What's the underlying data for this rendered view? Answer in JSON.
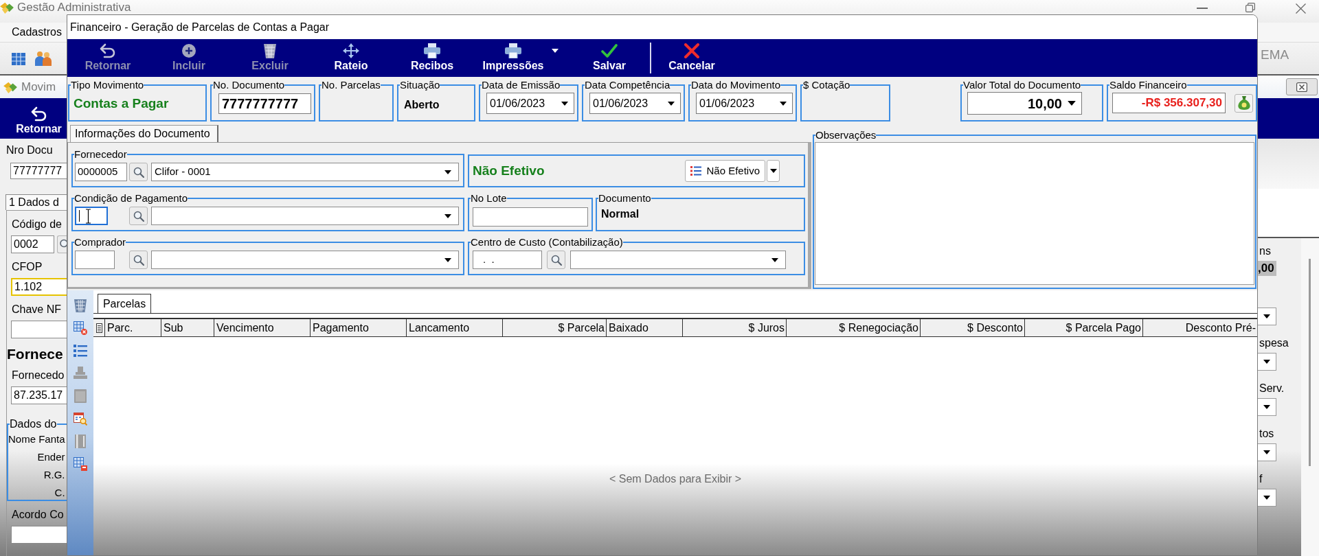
{
  "app": {
    "title": "Gestão Administrativa",
    "menu": [
      "Cadastros"
    ],
    "toolbar_text": "EMA"
  },
  "child_window": {
    "title": "Movim",
    "toolbar": [
      "Retornar"
    ],
    "doc_label": "Nro Docu",
    "doc_value": "77777777",
    "tab": {
      "label": "1 Dados d",
      "selected": true
    },
    "left_items": [
      {
        "kind": "label",
        "text": "Código de"
      },
      {
        "kind": "lookup",
        "value": "0002"
      },
      {
        "kind": "label",
        "text": "CFOP"
      },
      {
        "kind": "input",
        "value": "1.102",
        "highlighted": true
      },
      {
        "kind": "label",
        "text": "Chave NF"
      },
      {
        "kind": "input",
        "highlighted": false
      },
      {
        "kind": "heading",
        "text": "Fornece"
      },
      {
        "kind": "label",
        "text": "Fornecedo"
      },
      {
        "kind": "input",
        "value": "87.235.17",
        "highlighted": false
      },
      {
        "kind": "group",
        "label": "Dados do",
        "rows": [
          "Nome Fanta",
          "Ender",
          "R.G.",
          "C."
        ]
      },
      {
        "kind": "label",
        "text": "Acordo Co"
      },
      {
        "kind": "input",
        "highlighted": false
      }
    ],
    "right_items": [
      {
        "kind": "label",
        "text": "ns"
      },
      {
        "kind": "value",
        "text": ",00"
      },
      {
        "kind": "dropdown"
      },
      {
        "kind": "label",
        "text": "spesa"
      },
      {
        "kind": "dropdown"
      },
      {
        "kind": "label",
        "text": "Serv."
      },
      {
        "kind": "dropdown"
      },
      {
        "kind": "label",
        "text": "tos"
      },
      {
        "kind": "dropdown"
      },
      {
        "kind": "label",
        "text": "f"
      },
      {
        "kind": "dropdown"
      }
    ]
  },
  "dialog": {
    "title": "Financeiro - Geração de Parcelas de Contas a Pagar",
    "toolbar": [
      {
        "label": "Retornar",
        "disabled": true,
        "menu": false,
        "separated": false
      },
      {
        "label": "Incluir",
        "disabled": true,
        "menu": false,
        "separated": false
      },
      {
        "label": "Excluir",
        "disabled": true,
        "menu": false,
        "separated": false
      },
      {
        "label": "Rateio",
        "disabled": false,
        "menu": false,
        "separated": false
      },
      {
        "label": "Recibos",
        "disabled": false,
        "menu": false,
        "separated": false
      },
      {
        "label": "Impressões",
        "disabled": false,
        "menu": true,
        "separated": false
      },
      {
        "label": "Salvar",
        "disabled": false,
        "menu": false,
        "separated": false
      },
      {
        "label": "Cancelar",
        "disabled": false,
        "menu": false,
        "separated": true
      }
    ],
    "header": [
      {
        "kind": "status",
        "label": "Tipo Movimento",
        "value": "Contas a Pagar"
      },
      {
        "kind": "input",
        "label": "No. Documento",
        "value": "7777777777"
      },
      {
        "kind": "empty",
        "label": "No. Parcelas"
      },
      {
        "kind": "text",
        "label": "Situação",
        "value": "Aberto"
      },
      {
        "kind": "date",
        "label": "Data de Emissão",
        "value": "01/06/2023"
      },
      {
        "kind": "date",
        "label": "Data Competência",
        "value": "01/06/2023"
      },
      {
        "kind": "date",
        "label": "Data do Movimento",
        "value": "01/06/2023"
      },
      {
        "kind": "empty",
        "label": "$ Cotação"
      },
      {
        "kind": "amount",
        "label": "Valor Total do Documento",
        "value": "10,00"
      },
      {
        "kind": "balance",
        "label": "Saldo Financeiro",
        "value": "-R$ 356.307,30"
      }
    ],
    "document_tab": {
      "label": "Informações do Documento",
      "selected": true
    },
    "form_rows": [
      {
        "lookup": {
          "label": "Fornecedor",
          "code": "0000005",
          "name": "Clifor - 0001",
          "focused": false
        },
        "side": [
          {
            "kind": "efetivo",
            "status": "Não Efetivo",
            "button": "Não Efetivo"
          }
        ]
      },
      {
        "lookup": {
          "label": "Condição de Pagamento",
          "focused": true
        },
        "side": [
          {
            "kind": "input",
            "label": "No Lote"
          },
          {
            "kind": "text",
            "label": "Documento",
            "value": "Normal"
          }
        ]
      },
      {
        "lookup": {
          "label": "Comprador",
          "focused": false
        },
        "side": [
          {
            "kind": "lookup",
            "label": "Centro de Custo (Contabilização)",
            "code": ".  ."
          }
        ]
      }
    ],
    "notes": {
      "label": "Observações"
    },
    "grid_tools": [
      {
        "disabled": false
      },
      {
        "disabled": false
      },
      {
        "disabled": false
      },
      {
        "disabled": true
      },
      {
        "disabled": true
      },
      {
        "disabled": false
      },
      {
        "disabled": true
      },
      {
        "disabled": false
      }
    ],
    "grid": {
      "tab": {
        "label": "Parcelas",
        "selected": true
      },
      "columns": [
        {
          "label": "Parc.",
          "kind": "text"
        },
        {
          "label": "Sub",
          "kind": "text"
        },
        {
          "label": "Vencimento",
          "kind": "text"
        },
        {
          "label": "Pagamento",
          "kind": "text"
        },
        {
          "label": "Lancamento",
          "kind": "text"
        },
        {
          "label": "$ Parcela",
          "kind": "amount"
        },
        {
          "label": "Baixado",
          "kind": "text"
        },
        {
          "label": "$ Juros",
          "kind": "amount"
        },
        {
          "label": "$ Renegociação",
          "kind": "amount"
        },
        {
          "label": "$ Desconto",
          "kind": "amount"
        },
        {
          "label": "$ Parcela Pago",
          "kind": "amount"
        },
        {
          "label": "Desconto Pré-",
          "kind": "amount"
        }
      ],
      "empty_text": "< Sem Dados para Exibir >"
    }
  }
}
